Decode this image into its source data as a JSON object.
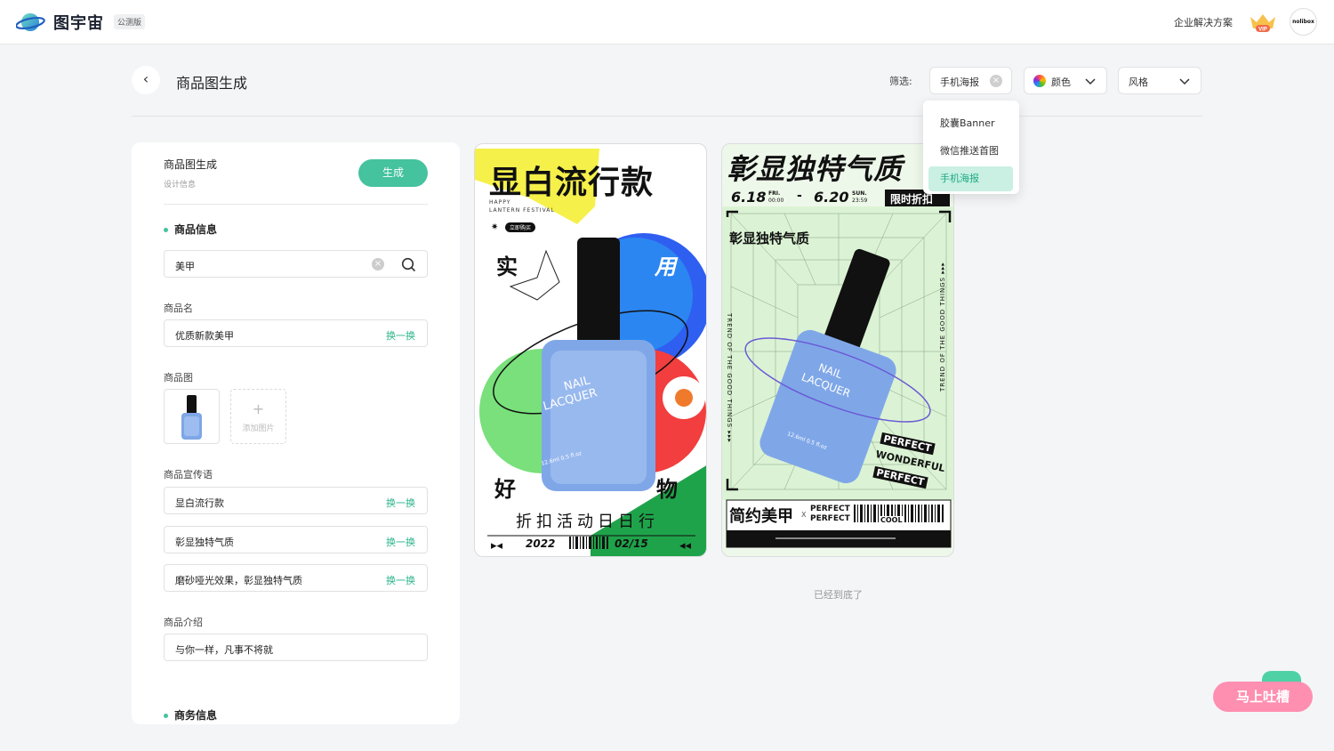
{
  "app": {
    "brand": "图宇宙",
    "badge": "公测版",
    "enterprise_link": "企业解决方案",
    "vip_label": "VIP",
    "avatar_text": "nolibox"
  },
  "header": {
    "title": "商品图生成",
    "filter_label": "筛选:",
    "filter_chip": "手机海报",
    "color_chip": "颜色",
    "style_chip": "风格"
  },
  "dropdown": {
    "items": [
      "胶囊Banner",
      "微信推送首图",
      "手机海报"
    ],
    "active_index": 2
  },
  "panel": {
    "title": "商品图生成",
    "subtitle": "设计信息",
    "generate_button": "生成",
    "section_product": "商品信息",
    "search_value": "美甲",
    "name_label": "商品名",
    "name_value": "优质新款美甲",
    "swap_label": "换一换",
    "image_label": "商品图",
    "add_image_label": "添加图片",
    "slogan_label": "商品宣传语",
    "slogans": [
      "显白流行款",
      "彰显独特气质",
      "磨砂哑光效果，彰显独特气质"
    ],
    "intro_label": "商品介绍",
    "intro_value": "与你一样，凡事不将就",
    "section_business": "商务信息"
  },
  "poster1": {
    "headline": "显白流行款",
    "sub1": "HAPPY",
    "sub2": "LANTERN FESTIVAL",
    "tag": "立即购买",
    "corner_tl": "实",
    "corner_tr": "用",
    "corner_bl": "好",
    "corner_br": "物",
    "bottle_text1": "NAIL",
    "bottle_text2": "LACQUER",
    "bottle_size": "12.6ml 0.5 fl.oz",
    "bottom_line": "折扣活动日日行",
    "year": "2022",
    "date": "02/15"
  },
  "poster2": {
    "headline": "彰显独特气质",
    "date_start": "6.18",
    "day_start": "FRI.",
    "time_start": "00:00",
    "date_end": "6.20",
    "day_end": "SUN.",
    "time_end": "23:59",
    "sale_tag": "限时折扣",
    "subhead": "彰显独特气质",
    "side_left": "TREND OF THE GOOD THINGS ▸▸▸",
    "side_right": "TREND OF THE GOOD THINGS ▸▸▸",
    "stamp1": "PERFECT",
    "stamp2": "WONDERFUL",
    "stamp3": "PERFECT",
    "footer_title": "简约美甲",
    "footer_x": "X",
    "footer_p1": "PERFECT",
    "footer_p2": "PERFECT",
    "footer_cool": "COOL",
    "bottle_text1": "NAIL",
    "bottle_text2": "LACQUER",
    "bottle_size": "12.6ml 0.5 fl.oz"
  },
  "end_text": "已经到底了",
  "feedback_button": "马上吐槽",
  "colors": {
    "accent": "#45c29e",
    "accent_text": "#2bb48a",
    "feedback": "#ff8fb0"
  }
}
